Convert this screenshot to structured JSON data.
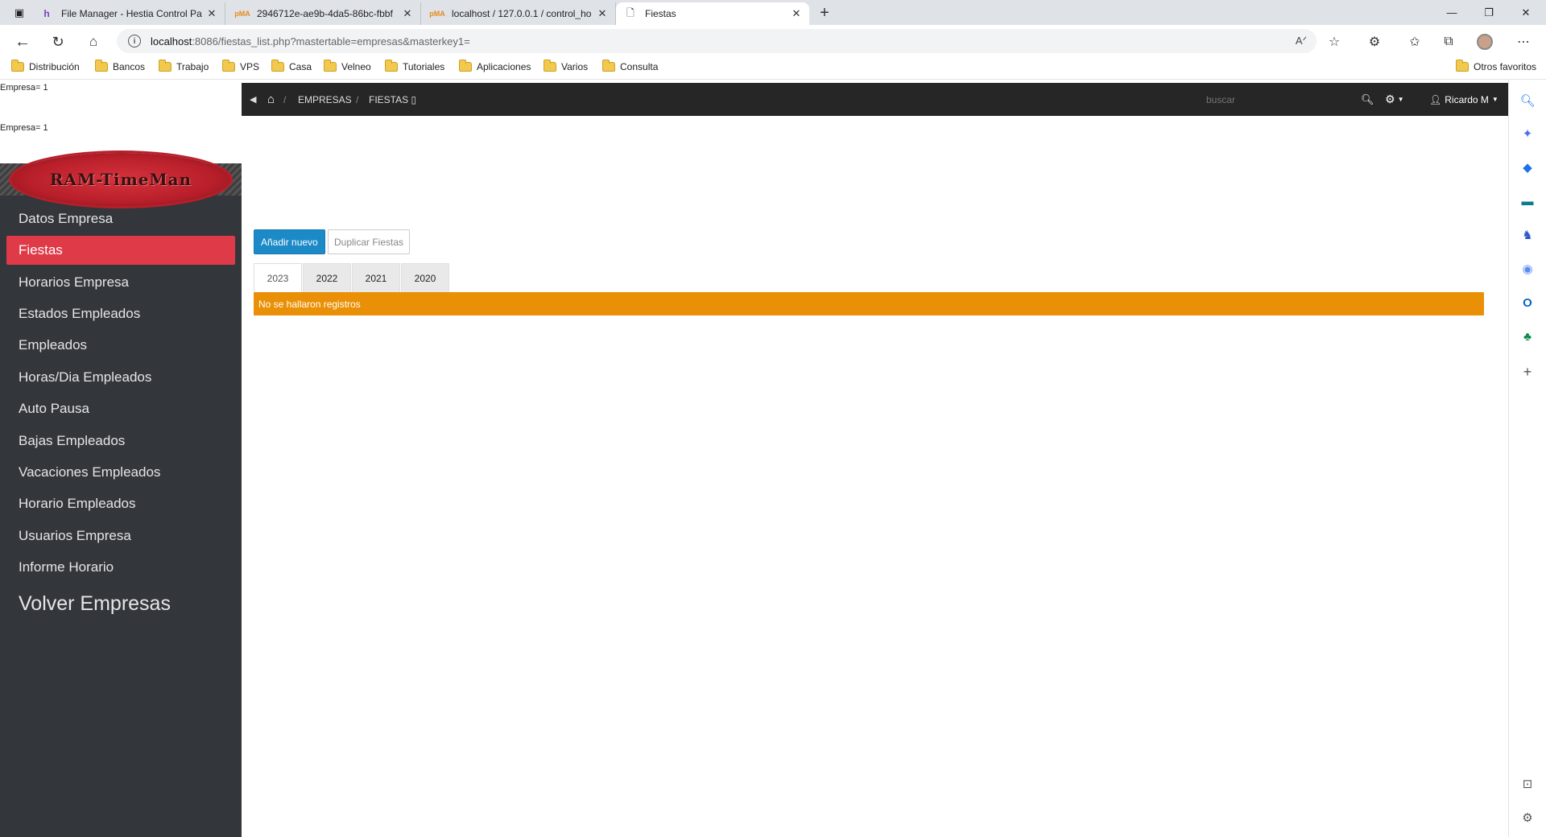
{
  "browser": {
    "tabs": [
      {
        "title": "File Manager - Hestia Control Pa",
        "icon": "hestia-icon"
      },
      {
        "title": "2946712e-ae9b-4da5-86bc-fbbf",
        "icon": "phpmyadmin-icon"
      },
      {
        "title": "localhost / 127.0.0.1 / control_ho",
        "icon": "phpmyadmin-icon"
      },
      {
        "title": "Fiestas",
        "icon": "page-icon"
      }
    ],
    "address": {
      "host": "localhost",
      "path": ":8086/fiestas_list.php?mastertable=empresas&masterkey1="
    },
    "bookmarks": [
      "Distribución",
      "Bancos",
      "Trabajo",
      "VPS",
      "Casa",
      "Velneo",
      "Tutoriales",
      "Aplicaciones",
      "Varios",
      "Consulta"
    ],
    "other_favorites": "Otros favoritos"
  },
  "page": {
    "debug_lines": [
      "Empresa= 1",
      "Empresa= 1"
    ],
    "logo_text": "RAM-TimeMan",
    "nav": {
      "items": [
        {
          "label": "Datos Empresa",
          "active": false
        },
        {
          "label": "Fiestas",
          "active": true
        },
        {
          "label": "Horarios Empresa",
          "active": false
        },
        {
          "label": "Estados Empleados",
          "active": false
        },
        {
          "label": "Empleados",
          "active": false
        },
        {
          "label": "Horas/Dia Empleados",
          "active": false
        },
        {
          "label": "Auto Pausa",
          "active": false
        },
        {
          "label": "Bajas Empleados",
          "active": false
        },
        {
          "label": "Vacaciones Empleados",
          "active": false
        },
        {
          "label": "Horario Empleados",
          "active": false
        },
        {
          "label": "Usuarios Empresa",
          "active": false
        },
        {
          "label": "Informe Horario",
          "active": false
        }
      ],
      "back_label": "Volver Empresas"
    },
    "topbar": {
      "breadcrumb": [
        "EMPRESAS",
        "FIESTAS ▯"
      ],
      "search_placeholder": "buscar",
      "user": "Ricardo M"
    },
    "buttons": {
      "add": "Añadir nuevo",
      "duplicate": "Duplicar Fiestas"
    },
    "year_tabs": [
      "2023",
      "2022",
      "2021",
      "2020"
    ],
    "active_year_tab": "2023",
    "alert_text": "No se hallaron registros"
  },
  "colors": {
    "nav_bg": "#33363b",
    "nav_active": "#df3a48",
    "topbar_bg": "#262626",
    "btn_primary": "#1c8ac7",
    "alert_bg": "#ea9006"
  }
}
